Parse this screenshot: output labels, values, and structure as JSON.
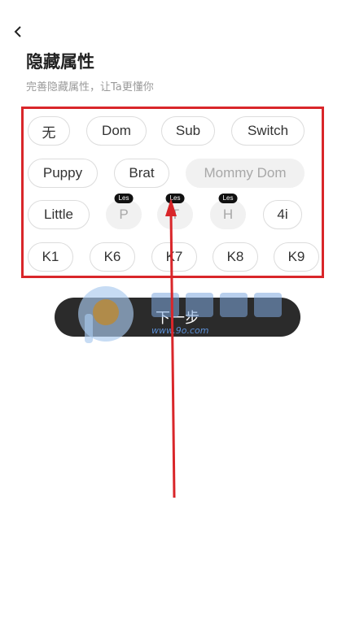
{
  "header": {
    "title": "隐藏属性",
    "subtitle": "完善隐藏属性，让Ta更懂你"
  },
  "tags": [
    {
      "label": "无",
      "disabled": false
    },
    {
      "label": "Dom",
      "disabled": false
    },
    {
      "label": "Sub",
      "disabled": false
    },
    {
      "label": "Switch",
      "disabled": false
    },
    {
      "label": "Puppy",
      "disabled": false
    },
    {
      "label": "Brat",
      "disabled": false
    },
    {
      "label": "Mommy Dom",
      "disabled": true
    },
    {
      "label": "Little",
      "disabled": false
    },
    {
      "label": "P",
      "disabled": true,
      "badge": "Les"
    },
    {
      "label": "T",
      "disabled": true,
      "badge": "Les"
    },
    {
      "label": "H",
      "disabled": true,
      "badge": "Les"
    },
    {
      "label": "4i",
      "disabled": false
    },
    {
      "label": "K1",
      "disabled": false
    },
    {
      "label": "K6",
      "disabled": false
    },
    {
      "label": "K7",
      "disabled": false
    },
    {
      "label": "K8",
      "disabled": false
    },
    {
      "label": "K9",
      "disabled": false
    }
  ],
  "next_button": {
    "label": "下一步"
  },
  "watermark": {
    "text": "www.9o.com"
  },
  "colors": {
    "highlight": "#d9262a",
    "button_bg": "#2b2b2b",
    "disabled_bg": "#f1f1f1"
  }
}
